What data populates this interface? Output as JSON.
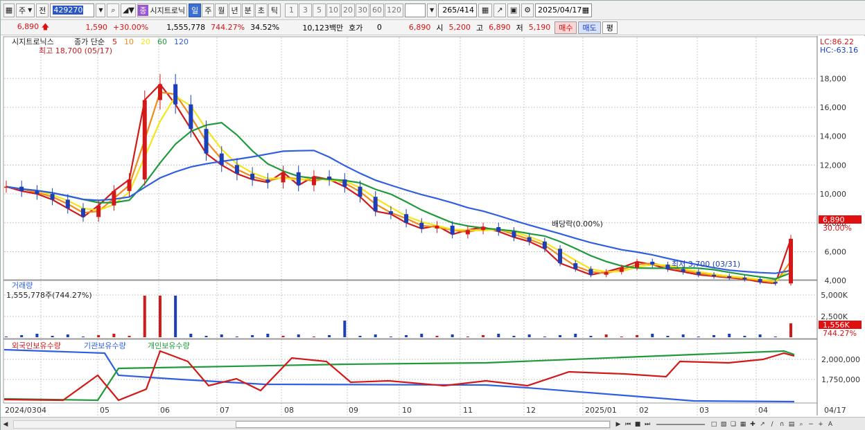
{
  "toolbar": {
    "market": "주",
    "prev_label": "전",
    "stock_code": "429270",
    "stock_name": "시지트로닉",
    "stock_badge": "종",
    "period_tabs": [
      "일",
      "주",
      "월",
      "년",
      "분",
      "초",
      "틱"
    ],
    "active_period": "일",
    "intervals": [
      "1",
      "3",
      "5",
      "10",
      "20",
      "30",
      "60",
      "120"
    ],
    "count_display": "265",
    "count_total": "/414",
    "date": "2025/04/17"
  },
  "quote": {
    "price": "6,890",
    "change": "1,590",
    "change_pct": "+30.00%",
    "volume": "1,555,778",
    "vol_ratio": "744.27%",
    "turnover": "34.52%",
    "amount": "10,123백만",
    "hoga_label": "호가",
    "hoga_value": "0",
    "ask": "6,890",
    "open_label": "시",
    "open": "5,200",
    "high_label": "고",
    "high": "6,890",
    "low_label": "저",
    "low": "5,190",
    "buy_label": "매수",
    "sell_label": "매도",
    "eval_label": "평"
  },
  "price_panel": {
    "title": "시지트로닉스",
    "indicator": "종가 단순",
    "ma_labels": [
      "5",
      "10",
      "20",
      "60",
      "120"
    ],
    "ma_colors": [
      "#d11919",
      "#f08a1a",
      "#f5e51a",
      "#1f9a3a",
      "#2f5fe0"
    ],
    "lc": "LC:86.22",
    "hc": "HC:-63.16",
    "high_note": "최고 18,700 (05/17)",
    "low_note": "최저 3,700 (03/31)",
    "dividend_note": "배당락(0.00%)",
    "current_tag": "6,890",
    "current_pct": "30.00%",
    "y_ticks": [
      "18,000",
      "16,000",
      "14,000",
      "12,000",
      "10,000",
      "8,000",
      "6,000",
      "4,000"
    ]
  },
  "volume_panel": {
    "title": "거래량",
    "value": "1,555,778주(744.27%)",
    "y_ticks": [
      "5,000K",
      "2,500K"
    ],
    "current_tag": "1,556K",
    "current_pct": "744.27%"
  },
  "holding_panel": {
    "legend": [
      "외국인보유수량",
      "기관보유수량",
      "개인보유수량"
    ],
    "legend_colors": [
      "#d11919",
      "#2f5fe0",
      "#1f9a3a"
    ],
    "y_ticks": [
      "2,000,000",
      "1,750,000"
    ]
  },
  "x_axis": {
    "labels": [
      "2024/03",
      "04",
      "05",
      "06",
      "07",
      "08",
      "09",
      "10",
      "11",
      "12",
      "2025/01",
      "02",
      "03",
      "04"
    ],
    "right_label": "04/17"
  },
  "chart_data": {
    "type": "candlestick",
    "price_series_close_approx": [
      10500,
      10200,
      10000,
      9600,
      9000,
      8400,
      9200,
      10200,
      11000,
      16500,
      17600,
      16200,
      14500,
      12800,
      12000,
      11400,
      11000,
      10800,
      11500,
      10600,
      11200,
      11000,
      10500,
      9800,
      8800,
      8600,
      8000,
      7600,
      7800,
      7200,
      7500,
      7700,
      7400,
      7000,
      6700,
      6200,
      5200,
      4800,
      4400,
      4600,
      4900,
      5300,
      5100,
      4800,
      4600,
      4400,
      4300,
      4200,
      4100,
      3900,
      3800,
      6890
    ],
    "moving_averages": [
      "5",
      "10",
      "20",
      "60",
      "120"
    ],
    "high": {
      "value": 18700,
      "date": "05/17"
    },
    "low": {
      "value": 3700,
      "date": "03/31"
    },
    "last": 6890
  }
}
